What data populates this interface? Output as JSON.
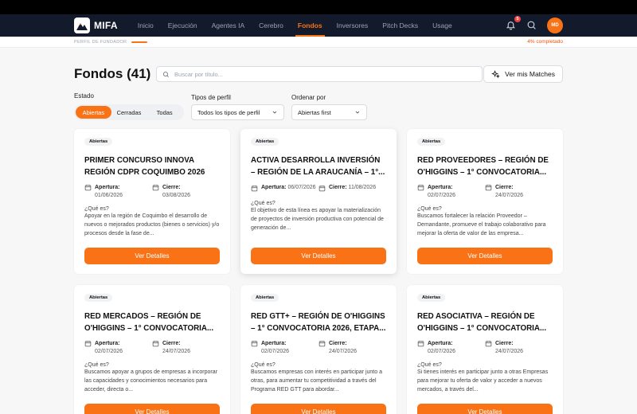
{
  "nav": {
    "logo_text": "MIFA",
    "items": [
      {
        "label": "Inicio",
        "active": false
      },
      {
        "label": "Ejecución",
        "active": false
      },
      {
        "label": "Agentes IA",
        "active": false
      },
      {
        "label": "Cerebro",
        "active": false
      },
      {
        "label": "Fondos",
        "active": true
      },
      {
        "label": "Inversores",
        "active": false
      },
      {
        "label": "Pitch Decks",
        "active": false
      },
      {
        "label": "Usage",
        "active": false
      }
    ],
    "notification_count": "5",
    "avatar_initials": "MD"
  },
  "progress": {
    "label": "PERFIL DE FUNDADOR",
    "value_text": "4% completado",
    "percent": 4
  },
  "page": {
    "title": "Fondos (41)",
    "search_placeholder": "Buscar por título...",
    "matches_button": "Ver mis Matches"
  },
  "filters": {
    "estado_label": "Estado",
    "estado_options": [
      "Abiertas",
      "Cerradas",
      "Todas"
    ],
    "tipos_label": "Tipos de perfil",
    "tipos_value": "Todos los tipos de perfil",
    "orden_label": "Ordenar por",
    "orden_value": "Abiertas first"
  },
  "colors": {
    "accent": "#f97316",
    "nav_bg": "#121a2b"
  },
  "cards": [
    {
      "badge": "Abiertas",
      "title": "PRIMER CONCURSO INNOVA REGIÓN CDPR COQUIMBO 2026",
      "apertura_label": "Apertura:",
      "apertura": "01/06/2026",
      "cierre_label": "Cierre:",
      "cierre": "03/08/2026",
      "que_es": "¿Qué es?",
      "description": "Apoyar en la región de Coquimbo el desarrollo de nuevos o mejorados productos (bienes o servicios) y/o procesos desde la fase de...",
      "button": "Ver Detalles"
    },
    {
      "badge": "Abiertas",
      "title": "ACTIVA DESARROLLA INVERSIÓN – REGIÓN DE LA ARAUCANÍA – 1°...",
      "apertura_label": "Apertura:",
      "apertura": "06/07/2026",
      "cierre_label": "Cierre:",
      "cierre": "11/08/2026",
      "que_es": "¿Qué es?",
      "description": "El objetivo de esta línea es apoyar la materialización de proyectos de inversión productiva con potencial de generación de...",
      "button": "Ver Detalles"
    },
    {
      "badge": "Abiertas",
      "title": "RED PROVEEDORES – REGIÓN DE O'HIGGINS – 1° CONVOCATORIA...",
      "apertura_label": "Apertura:",
      "apertura": "02/07/2026",
      "cierre_label": "Cierre:",
      "cierre": "24/07/2026",
      "que_es": "¿Qué es?",
      "description": "Buscamos fortalecer la relación Proveedor – Demandante, promueve el trabajo colaborativo para mejorar la oferta de valor de las empresa...",
      "button": "Ver Detalles"
    },
    {
      "badge": "Abiertas",
      "title": "RED MERCADOS – REGIÓN DE O'HIGGINS – 1° CONVOCATORIA...",
      "apertura_label": "Apertura:",
      "apertura": "02/07/2026",
      "cierre_label": "Cierre:",
      "cierre": "24/07/2026",
      "que_es": "¿Qué es?",
      "description": "Buscamos apoyar a grupos de empresas a incorporar las capacidades y conocimientos necesarios para acceder, directa o...",
      "button": "Ver Detalles"
    },
    {
      "badge": "Abiertas",
      "title": "RED GTT+ – REGIÓN DE O'HIGGINS – 1° CONVOCATORIA 2026, ETAPA...",
      "apertura_label": "Apertura:",
      "apertura": "02/07/2026",
      "cierre_label": "Cierre:",
      "cierre": "24/07/2026",
      "que_es": "¿Qué es?",
      "description": "Buscamos empresas con interés en participar junto a otras, para aumentar tu competitividad a través del Programa RED GTT para abordar...",
      "button": "Ver Detalles"
    },
    {
      "badge": "Abiertas",
      "title": "RED ASOCIATIVA – REGIÓN DE O'HIGGINS – 1° CONVOCATORIA...",
      "apertura_label": "Apertura:",
      "apertura": "02/07/2026",
      "cierre_label": "Cierre:",
      "cierre": "24/07/2026",
      "que_es": "¿Qué es?",
      "description": "Si tienes interés en participar junto a otras Empresas para mejorar tu oferta de valor y acceder a nuevos mercados, a través del...",
      "button": "Ver Detalles"
    }
  ]
}
